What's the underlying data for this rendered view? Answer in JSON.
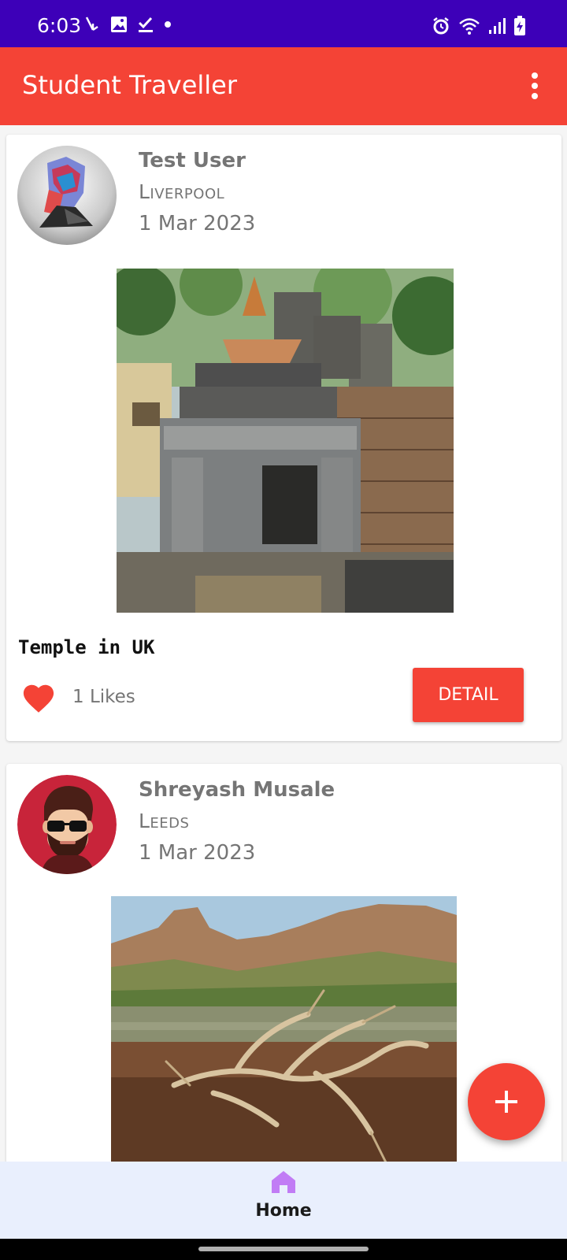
{
  "status_bar": {
    "time": "6:03",
    "left_icons": [
      "missed-call-icon",
      "image-icon",
      "check-download-icon",
      "dot-icon"
    ],
    "right_icons": [
      "alarm-icon",
      "wifi-icon",
      "signal-icon",
      "battery-charging-icon"
    ],
    "background": "#3d00b8"
  },
  "app_bar": {
    "title": "Student Traveller",
    "menu_icon": "more-vert-icon",
    "background": "#f44336"
  },
  "posts": [
    {
      "user_name": "Test User",
      "location": "Liverpool",
      "date": "1 Mar 2023",
      "avatar": "abstract-bust-avatar",
      "image": "stone-temple-photo",
      "title": "Temple in UK",
      "likes": "1 Likes",
      "detail_label": "DETAIL"
    },
    {
      "user_name": "Shreyash Musale",
      "location": "Leeds",
      "date": "1 Mar 2023",
      "avatar": "cartoon-man-sunglasses-avatar",
      "image": "mountain-lake-driftwood-photo"
    }
  ],
  "fab": {
    "icon": "plus-icon"
  },
  "bottom_nav": {
    "items": [
      {
        "label": "Home",
        "icon": "home-icon",
        "active": true
      }
    ]
  },
  "colors": {
    "accent": "#f44336",
    "status_bar": "#3d00b8",
    "bottom_nav": "#e9effd",
    "home_icon": "#c17cf5"
  }
}
